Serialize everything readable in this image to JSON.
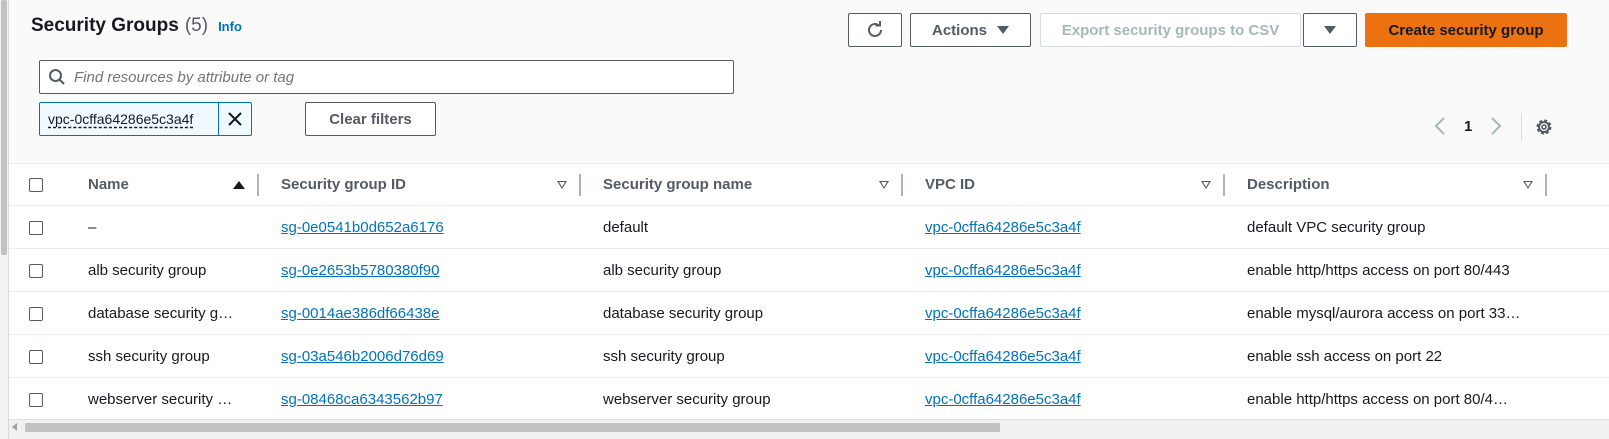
{
  "header": {
    "title": "Security Groups",
    "count": "(5)",
    "info_label": "Info"
  },
  "toolbar": {
    "refresh_icon": "refresh-icon",
    "actions_label": "Actions",
    "export_label": "Export security groups to CSV",
    "create_label": "Create security group"
  },
  "search": {
    "placeholder": "Find resources by attribute or tag",
    "value": ""
  },
  "filters": {
    "tokens": [
      "vpc-0cffa64286e5c3a4f"
    ],
    "clear_label": "Clear filters"
  },
  "pagination": {
    "current_page": "1"
  },
  "table": {
    "columns": [
      "Name",
      "Security group ID",
      "Security group name",
      "VPC ID",
      "Description"
    ],
    "rows": [
      {
        "name": "–",
        "group_id": "sg-0e0541b0d652a6176",
        "group_name": "default",
        "vpc_id": "vpc-0cffa64286e5c3a4f",
        "description": "default VPC security group"
      },
      {
        "name": "alb security group",
        "group_id": "sg-0e2653b5780380f90",
        "group_name": "alb security group",
        "vpc_id": "vpc-0cffa64286e5c3a4f",
        "description": "enable http/https access on port 80/443"
      },
      {
        "name": "database security g…",
        "group_id": "sg-0014ae386df66438e",
        "group_name": "database security group",
        "vpc_id": "vpc-0cffa64286e5c3a4f",
        "description": "enable mysql/aurora access on port 33…"
      },
      {
        "name": "ssh security group",
        "group_id": "sg-03a546b2006d76d69",
        "group_name": "ssh security group",
        "vpc_id": "vpc-0cffa64286e5c3a4f",
        "description": "enable ssh access on port 22"
      },
      {
        "name": "webserver security …",
        "group_id": "sg-08468ca6343562b97",
        "group_name": "webserver security group",
        "vpc_id": "vpc-0cffa64286e5c3a4f",
        "description": "enable http/https access on port 80/4…"
      }
    ]
  },
  "colors": {
    "primary_button": "#ec7211",
    "link": "#0073bb",
    "text": "#16191f",
    "secondary_text": "#545b64"
  }
}
